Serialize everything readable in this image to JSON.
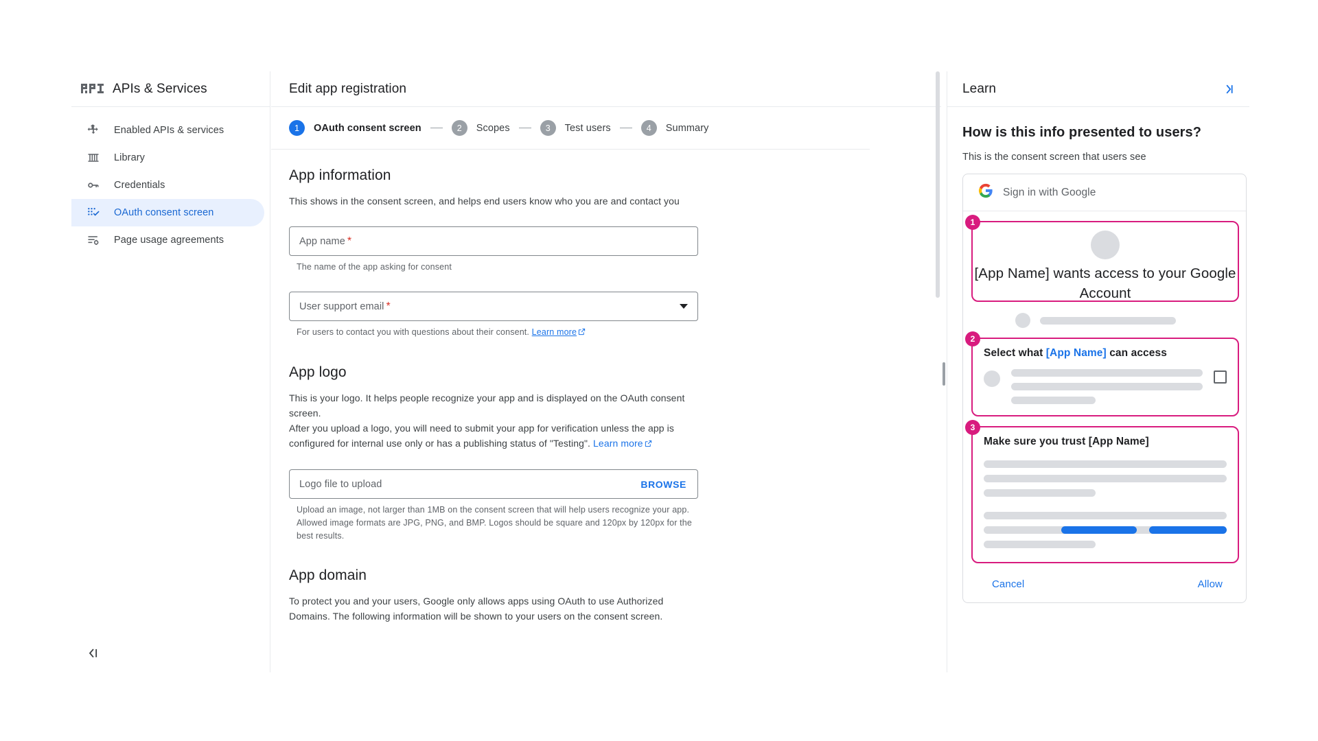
{
  "sidebar": {
    "logo_text": "API",
    "title": "APIs & Services",
    "items": [
      {
        "label": "Enabled APIs & services",
        "icon": "dashboard-icon",
        "active": false
      },
      {
        "label": "Library",
        "icon": "library-icon",
        "active": false
      },
      {
        "label": "Credentials",
        "icon": "key-icon",
        "active": false
      },
      {
        "label": "OAuth consent screen",
        "icon": "consent-icon",
        "active": true
      },
      {
        "label": "Page usage agreements",
        "icon": "agreements-icon",
        "active": false
      }
    ],
    "collapse_icon": "collapse-left-icon"
  },
  "main": {
    "title": "Edit app registration",
    "steps": [
      {
        "num": "1",
        "label": "OAuth consent screen",
        "active": true
      },
      {
        "num": "2",
        "label": "Scopes",
        "active": false
      },
      {
        "num": "3",
        "label": "Test users",
        "active": false
      },
      {
        "num": "4",
        "label": "Summary",
        "active": false
      }
    ],
    "app_information": {
      "heading": "App information",
      "description": "This shows in the consent screen, and helps end users know who you are and contact you",
      "app_name_field": {
        "label": "App name",
        "required_marker": "*",
        "value": "",
        "hint": "The name of the app asking for consent"
      },
      "user_support_email_field": {
        "label": "User support email",
        "required_marker": "*",
        "value": "",
        "hint_before": "For users to contact you with questions about their consent. ",
        "hint_link": "Learn more"
      }
    },
    "app_logo": {
      "heading": "App logo",
      "description_line1": "This is your logo. It helps people recognize your app and is displayed on the OAuth consent screen.",
      "description_line2_before": "After you upload a logo, you will need to submit your app for verification unless the app is configured for internal use only or has a publishing status of \"Testing\". ",
      "description_link": "Learn more",
      "upload_field": {
        "label": "Logo file to upload",
        "value": "",
        "browse_label": "BROWSE"
      },
      "upload_hint": "Upload an image, not larger than 1MB on the consent screen that will help users recognize your app. Allowed image formats are JPG, PNG, and BMP. Logos should be square and 120px by 120px for the best results."
    },
    "app_domain": {
      "heading": "App domain",
      "description": "To protect you and your users, Google only allows apps using OAuth to use Authorized Domains. The following information will be shown to your users on the consent screen."
    }
  },
  "learn": {
    "title": "Learn",
    "collapse_icon": "expand-right-icon",
    "heading": "How is this info presented to users?",
    "subheading": "This is the consent screen that users see",
    "consent_preview": {
      "signin_text": "Sign in with Google",
      "google_icon": "google-g-icon",
      "callout1": {
        "badge": "1",
        "text": "[App Name] wants access to your Google Account"
      },
      "callout2": {
        "badge": "2",
        "title_before": "Select what ",
        "title_appname": "[App Name]",
        "title_after": " can access"
      },
      "callout3": {
        "badge": "3",
        "title": "Make sure you trust [App Name]"
      },
      "cancel_label": "Cancel",
      "allow_label": "Allow"
    }
  },
  "colors": {
    "accent_blue": "#1a73e8",
    "callout_pink": "#d81b7e",
    "required_red": "#d93025",
    "active_nav_bg": "#e8f0fe",
    "skeleton_gray": "#dadce0"
  }
}
